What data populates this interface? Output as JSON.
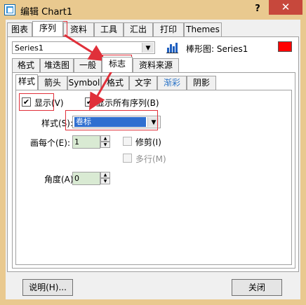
{
  "window": {
    "title": "编辑 Chart1",
    "help": "?",
    "close": "✕"
  },
  "main_tabs": [
    {
      "label": "图表"
    },
    {
      "label": "序列"
    },
    {
      "label": "资料"
    },
    {
      "label": "工具"
    },
    {
      "label": "汇出"
    },
    {
      "label": "打印"
    },
    {
      "label": "Themes"
    }
  ],
  "series": {
    "selected": "Series1",
    "chart_type_label": "棒形图: Series1",
    "color": "#ff0000"
  },
  "sub_tabs": [
    {
      "label": "格式"
    },
    {
      "label": "堆迭图"
    },
    {
      "label": "一般"
    },
    {
      "label": "标志"
    },
    {
      "label": "资料来源"
    }
  ],
  "marks_tabs": [
    {
      "label": "样式"
    },
    {
      "label": "箭头"
    },
    {
      "label": "Symbol"
    },
    {
      "label": "格式"
    },
    {
      "label": "文字"
    },
    {
      "label": "渐彩"
    },
    {
      "label": "阴影"
    }
  ],
  "marks": {
    "visible_label": "显示(V)",
    "visible_checked": "✔",
    "all_series_label": "显示所有序列(B)",
    "all_series_checked": "✔",
    "style_label": "样式(S):",
    "style_value": "卷标",
    "every_label": "画每个(E):",
    "every_value": "1",
    "clip_label": "修剪(I)",
    "multiline_label": "多行(M)",
    "angle_label": "角度(A):",
    "angle_value": "0"
  },
  "buttons": {
    "help": "说明(H)...",
    "close": "关闭"
  },
  "colors": {
    "annotation": "#e0303a",
    "accent": "#2b74c7"
  }
}
